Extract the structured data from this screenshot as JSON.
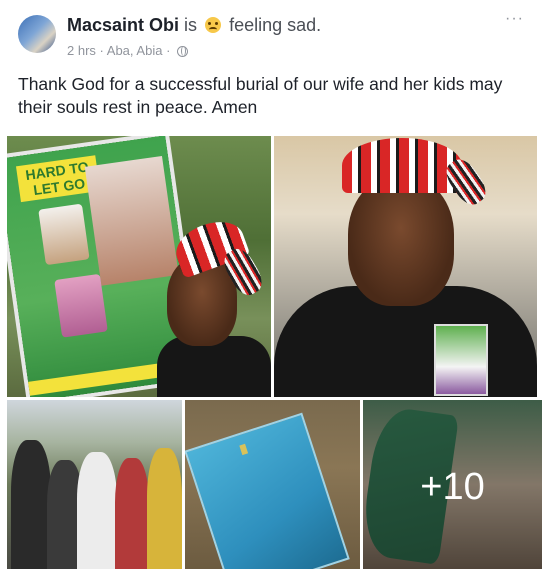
{
  "post": {
    "author": "Macsaint Obi",
    "is_text": "is",
    "feeling_text": "feeling sad.",
    "feeling_emoji": "sad-face-emoji",
    "time": "2 hrs",
    "location": "Aba, Abia",
    "separator": "·",
    "privacy_icon": "globe-icon",
    "more_menu": "···",
    "text": "Thank God for a successful burial of our wife and her kids may their souls rest in peace. Amen"
  },
  "photos": {
    "poster_text": "HARD TO LET GO",
    "additional_count": "+10"
  },
  "colors": {
    "text_primary": "#1d2129",
    "text_secondary": "#90949c",
    "feeling_text": "#4b4f56",
    "background": "#ffffff"
  }
}
